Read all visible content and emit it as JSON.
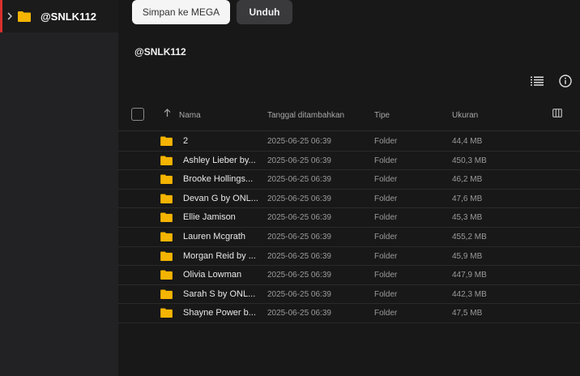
{
  "sidebar": {
    "items": [
      {
        "label": "@SNLK112",
        "icon": "folder-icon",
        "expanded": false,
        "selected": true
      }
    ]
  },
  "toolbar": {
    "save_label": "Simpan ke MEGA",
    "download_label": "Unduh"
  },
  "main": {
    "title": "@SNLK112",
    "icons": [
      "list-view-icon",
      "info-icon",
      "columns-icon"
    ],
    "columns": {
      "name": "Nama",
      "date": "Tanggal ditambahkan",
      "type": "Tipe",
      "size": "Ukuran"
    },
    "rows": [
      {
        "name": "2",
        "date": "2025-06-25 06:39",
        "type": "Folder",
        "size": "44,4 MB"
      },
      {
        "name": "Ashley Lieber by...",
        "date": "2025-06-25 06:39",
        "type": "Folder",
        "size": "450,3 MB"
      },
      {
        "name": "Brooke Hollings...",
        "date": "2025-06-25 06:39",
        "type": "Folder",
        "size": "46,2 MB"
      },
      {
        "name": "Devan G by ONL...",
        "date": "2025-06-25 06:39",
        "type": "Folder",
        "size": "47,6 MB"
      },
      {
        "name": "Ellie Jamison",
        "date": "2025-06-25 06:39",
        "type": "Folder",
        "size": "45,3 MB"
      },
      {
        "name": "Lauren Mcgrath",
        "date": "2025-06-25 06:39",
        "type": "Folder",
        "size": "455,2 MB"
      },
      {
        "name": "Morgan Reid by ...",
        "date": "2025-06-25 06:39",
        "type": "Folder",
        "size": "45,9 MB"
      },
      {
        "name": "Olivia Lowman",
        "date": "2025-06-25 06:39",
        "type": "Folder",
        "size": "447,9 MB"
      },
      {
        "name": "Sarah S by ONL...",
        "date": "2025-06-25 06:39",
        "type": "Folder",
        "size": "442,3 MB"
      },
      {
        "name": "Shayne Power b...",
        "date": "2025-06-25 06:39",
        "type": "Folder",
        "size": "47,5 MB"
      }
    ]
  },
  "colors": {
    "folder": "#f4b400",
    "accent": "#d9302c",
    "background": "#181818",
    "sidebar": "#222224"
  }
}
